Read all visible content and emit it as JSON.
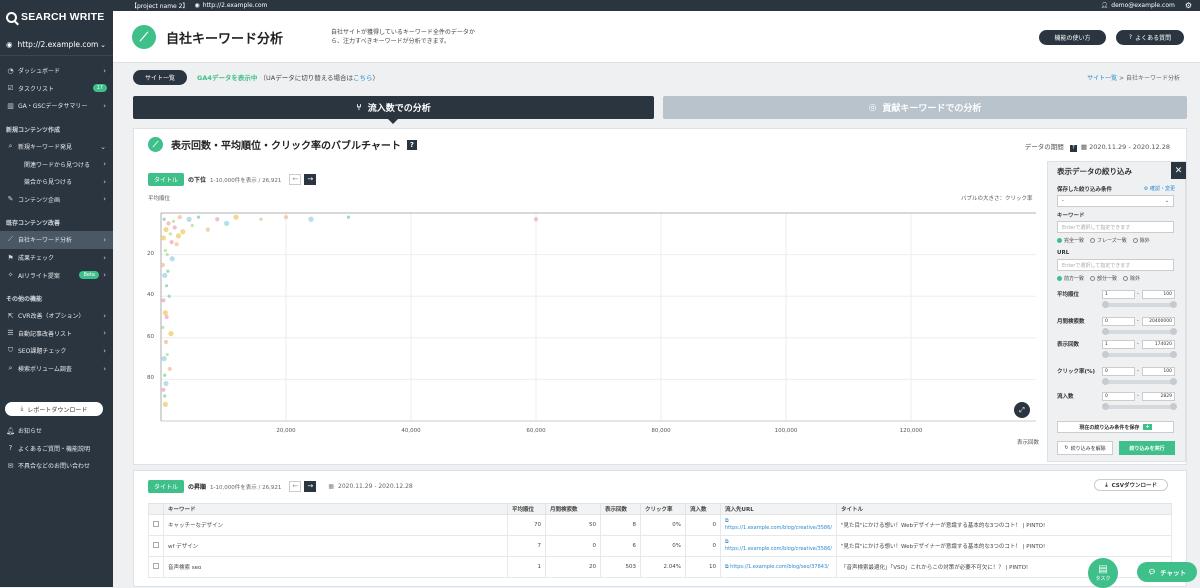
{
  "brand": "SEARCH WRITE",
  "topbar": {
    "project": "【project name 2】",
    "url": "http://2.example.com",
    "user": "demo@example.com"
  },
  "sidebar": {
    "site": "http://2.example.com",
    "items": [
      {
        "label": "ダッシュボード",
        "icon": "gauge-icon"
      },
      {
        "label": "タスクリスト",
        "badge": "17",
        "icon": "check-icon"
      },
      {
        "label": "GA・GSCデータサマリー",
        "icon": "chart-icon"
      }
    ],
    "sec1": "新規コンテンツ作成",
    "sec1_items": [
      {
        "label": "新規キーワード発見"
      },
      {
        "label": "関連ワードから見つける",
        "sub": true
      },
      {
        "label": "競合から見つける",
        "sub": true
      },
      {
        "label": "コンテンツ企画"
      }
    ],
    "sec2": "既存コンテンツ改善",
    "sec2_items": [
      {
        "label": "自社キーワード分析",
        "active": true
      },
      {
        "label": "成果チェック"
      },
      {
        "label": "AIリライト提案",
        "badge": "Beta"
      }
    ],
    "sec3": "その他の機能",
    "sec3_items": [
      {
        "label": "CVR改善（オプション）"
      },
      {
        "label": "自動記事改善リスト"
      },
      {
        "label": "SEO課題チェック"
      },
      {
        "label": "検索ボリューム調査"
      }
    ],
    "download": "レポートダウンロード",
    "footer": [
      {
        "label": "お知らせ",
        "icon": "bell-icon"
      },
      {
        "label": "よくあるご質問・機能説明",
        "icon": "question-icon"
      },
      {
        "label": "不具合などのお問い合わせ",
        "icon": "mail-icon"
      }
    ]
  },
  "header": {
    "title": "自社キーワード分析",
    "desc": "自社サイトが獲得しているキーワード全件のデータから、注力すべきキーワードが分析できます。",
    "btn1": "機能の使い方",
    "btn2": "よくある質問"
  },
  "toolbar": {
    "site_list": "サイト一覧",
    "ga": "GA4データを表示中",
    "ua": "（UAデータに切り替える場合は",
    "ua_link": "こちら",
    "ua_end": "）"
  },
  "breadcrumb": {
    "link": "サイト一覧",
    "sep": ">",
    "current": "自社キーワード分析"
  },
  "tabs": {
    "inflow": "流入数での分析",
    "contrib": "貢献キーワードでの分析"
  },
  "chart_card": {
    "title": "表示回数・平均順位・クリック率のバブルチャート",
    "qm": "?",
    "period_label": "データの期間",
    "period": "2020.11.29 - 2020.12.28",
    "tag": "タイトル",
    "lower": "の下位",
    "count": "1-10,000件を表示 / 26,921",
    "ylab": "平均順位",
    "bubble": "バブルの大きさ：クリック率",
    "xlab": "表示回数"
  },
  "chart_data": {
    "type": "scatter",
    "xlabel": "表示回数",
    "ylabel": "平均順位",
    "x_ticks": [
      "20,000",
      "40,000",
      "60,000",
      "80,000",
      "100,000",
      "120,000"
    ],
    "y_ticks": [
      "20",
      "40",
      "60",
      "80"
    ],
    "xlim": [
      0,
      140000
    ],
    "ylim": [
      0,
      100
    ],
    "y_inverted": true,
    "points": [
      [
        500,
        3
      ],
      [
        1200,
        5
      ],
      [
        800,
        8
      ],
      [
        2000,
        4
      ],
      [
        3000,
        2
      ],
      [
        4500,
        3
      ],
      [
        6000,
        2
      ],
      [
        9000,
        3
      ],
      [
        12000,
        2
      ],
      [
        16000,
        3
      ],
      [
        20000,
        2
      ],
      [
        24000,
        3
      ],
      [
        30000,
        2
      ],
      [
        60000,
        3
      ],
      [
        400,
        12
      ],
      [
        700,
        18
      ],
      [
        300,
        25
      ],
      [
        600,
        30
      ],
      [
        900,
        35
      ],
      [
        400,
        42
      ],
      [
        700,
        48
      ],
      [
        300,
        55
      ],
      [
        800,
        62
      ],
      [
        500,
        70
      ],
      [
        600,
        78
      ],
      [
        400,
        85
      ],
      [
        700,
        92
      ],
      [
        1500,
        10
      ],
      [
        2500,
        15
      ],
      [
        1800,
        22
      ],
      [
        1100,
        28
      ],
      [
        2200,
        7
      ],
      [
        3500,
        9
      ],
      [
        5000,
        6
      ],
      [
        7500,
        8
      ],
      [
        10500,
        5
      ],
      [
        1300,
        40
      ],
      [
        900,
        50
      ],
      [
        1600,
        58
      ],
      [
        1000,
        68
      ],
      [
        1400,
        75
      ],
      [
        800,
        82
      ],
      [
        600,
        88
      ],
      [
        1700,
        14
      ],
      [
        2800,
        11
      ],
      [
        1000,
        20
      ]
    ]
  },
  "filter": {
    "title": "表示データの絞り込み",
    "saved": "保存した絞り込み条件",
    "saved_link": "確認・変更",
    "select": "-",
    "kw_label": "キーワード",
    "kw_ph": "Enterで選択して指定できます",
    "kw_opts": [
      "完全一致",
      "フレーズ一致",
      "除外"
    ],
    "url_label": "URL",
    "url_ph": "Enterで選択して指定できます",
    "url_opts": [
      "前方一致",
      "部分一致",
      "除外"
    ],
    "ranges": [
      {
        "label": "平均順位",
        "min": "1",
        "max": "100"
      },
      {
        "label": "月間検索数",
        "min": "0",
        "max": "20400000"
      },
      {
        "label": "表示回数",
        "min": "1",
        "max": "174020"
      },
      {
        "label": "クリック率(%)",
        "min": "0",
        "max": "100"
      },
      {
        "label": "流入数",
        "min": "0",
        "max": "2829"
      }
    ],
    "save": "現在の絞り込み条件を保存",
    "clear": "絞り込みを解除",
    "exec": "絞り込みを実行"
  },
  "table_card": {
    "tag": "タイトル",
    "upper": "の昇順",
    "count": "1-10,000件を表示 / 26,921",
    "period": "2020.11.29 - 2020.12.28",
    "csv": "CSVダウンロード",
    "headers": [
      "キーワード",
      "平均順位",
      "月間検索数",
      "表示回数",
      "クリック率",
      "流入数",
      "流入先URL",
      "タイトル"
    ],
    "rows": [
      {
        "kw": "キャッチーなデザイン",
        "rank": "70",
        "vol": "50",
        "imp": "8",
        "ctr": "0%",
        "inflow": "0",
        "url": "https://1.example.com/blog/creative/3586/",
        "title": "\"見た目\"にかける想い！Webデザイナーが意識する基本的な3つのコト！ | PINTO!"
      },
      {
        "kw": "wf デザイン",
        "rank": "7",
        "vol": "0",
        "imp": "6",
        "ctr": "0%",
        "inflow": "0",
        "url": "https://1.example.com/blog/creative/3586/",
        "title": "\"見た目\"にかける想い！Webデザイナーが意識する基本的な3つのコト！ | PINTO!"
      },
      {
        "kw": "音声検索 seo",
        "rank": "1",
        "vol": "20",
        "imp": "503",
        "ctr": "2.04%",
        "inflow": "10",
        "url": "https://1.example.com/blog/seo/37843/",
        "title": "「音声検索最適化」「VSO」これからこの対策が必要不可欠に！？ | PINTO!"
      }
    ]
  },
  "fab": {
    "task": "タスク",
    "chat": "チャット"
  }
}
